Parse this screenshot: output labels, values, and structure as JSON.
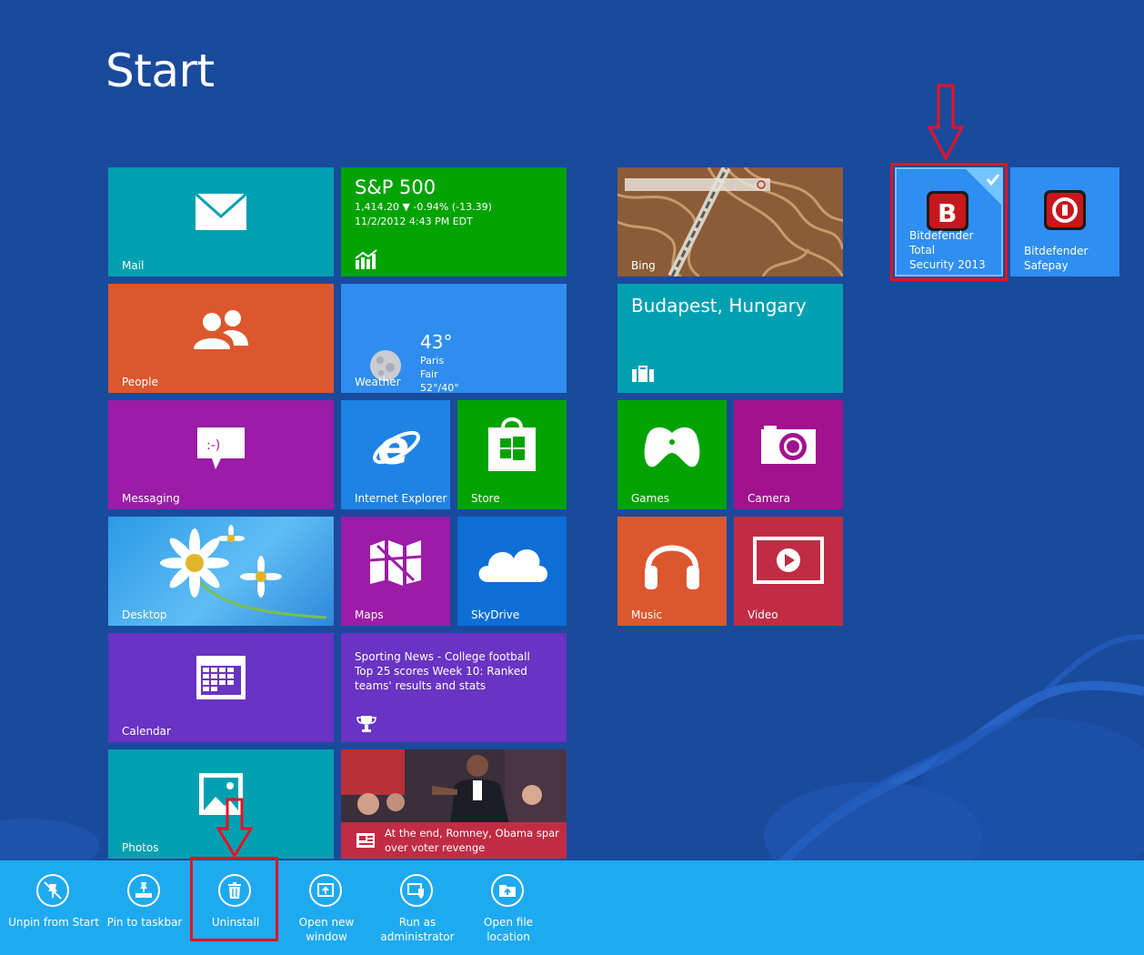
{
  "start_title": "Start",
  "tiles": {
    "mail": "Mail",
    "finance": {
      "name": "S&P 500",
      "value_line": "1,414.20 ▼ -0.94% (-13.39)",
      "time_line": "11/2/2012 4:43 PM EDT"
    },
    "bing": "Bing",
    "people": "People",
    "weather": {
      "label": "Weather",
      "temp": "43°",
      "city": "Paris",
      "condition": "Fair",
      "range": "52°/40°"
    },
    "travel": "Budapest, Hungary",
    "messaging": "Messaging",
    "internet_explorer": "Internet Explorer",
    "store": "Store",
    "games": "Games",
    "camera": "Camera",
    "desktop": "Desktop",
    "maps": "Maps",
    "skydrive": "SkyDrive",
    "music": "Music",
    "video": "Video",
    "calendar": "Calendar",
    "sports": "Sporting News - College football Top 25 scores Week 10: Ranked teams' results and stats",
    "photos": "Photos",
    "news": "At the end, Romney, Obama spar over voter revenge",
    "bitdefender_total_line1": "Bitdefender Total",
    "bitdefender_total_line2": "Security 2013",
    "bitdefender_safepay_line1": "Bitdefender",
    "bitdefender_safepay_line2": "Safepay"
  },
  "appbar": {
    "unpin": "Unpin from Start",
    "pin_taskbar": "Pin to taskbar",
    "uninstall": "Uninstall",
    "open_window_line1": "Open new",
    "open_window_line2": "window",
    "run_admin_line1": "Run as",
    "run_admin_line2": "administrator",
    "open_location_line1": "Open file",
    "open_location_line2": "location"
  },
  "colors": {
    "background": "#1a4a9c",
    "appbar": "#1eaaf1",
    "highlight": "#e81123"
  }
}
